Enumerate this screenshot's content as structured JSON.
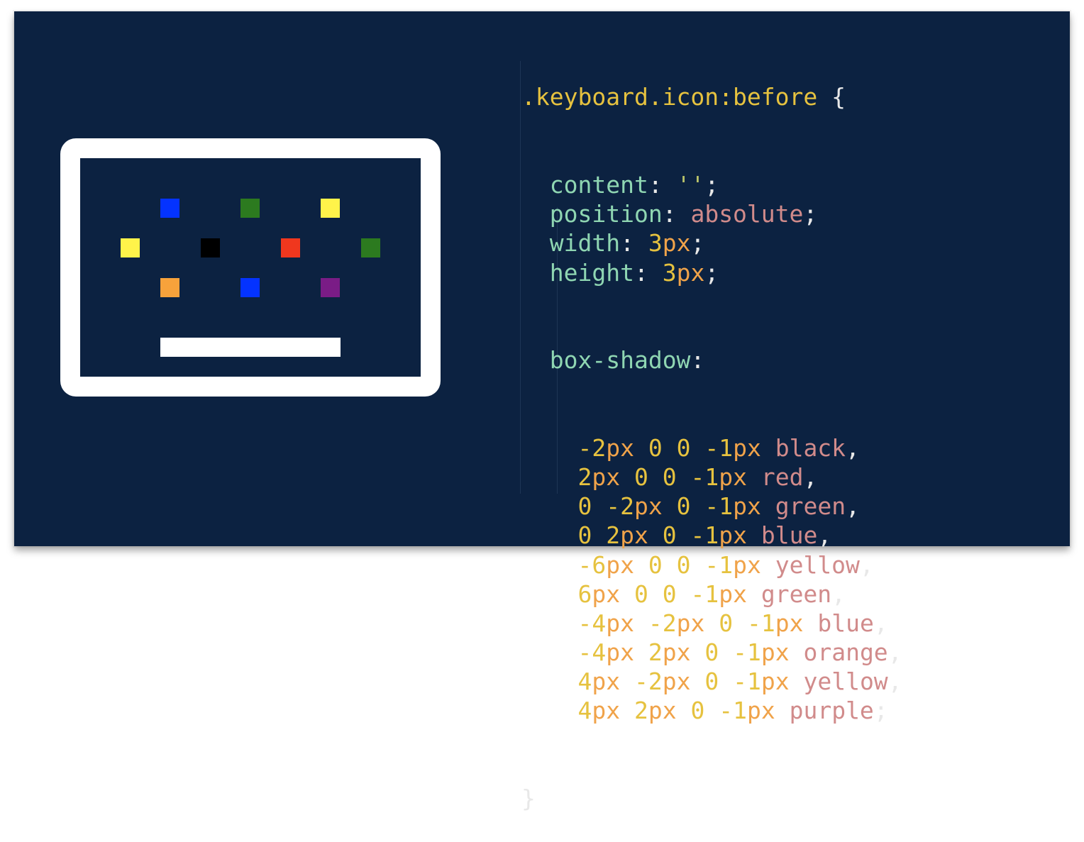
{
  "keyboard_icon": {
    "frame_color": "#ffffff",
    "background_color": "#0c2241",
    "key_colors": [
      "blue",
      "green",
      "yellow",
      "yellow",
      "black",
      "red",
      "green",
      "orange",
      "blue",
      "purple"
    ],
    "color_map": {
      "blue": "#0433ff",
      "green": "#2c7a1f",
      "yellow": "#fff34a",
      "black": "#000000",
      "red": "#f0371e",
      "orange": "#f7a23b",
      "purple": "#7a1c86"
    }
  },
  "code": {
    "selector": ".keyboard.icon:before",
    "open_brace": " {",
    "close_brace": "}",
    "declarations": [
      {
        "prop": "content",
        "value": "''",
        "type": "str"
      },
      {
        "prop": "position",
        "value": "absolute",
        "type": "kw"
      },
      {
        "prop": "width",
        "num": "3",
        "unit": "px"
      },
      {
        "prop": "height",
        "num": "3",
        "unit": "px"
      }
    ],
    "box_shadow_prop": "box-shadow",
    "shadows": [
      [
        "-2",
        "px",
        " 0 0 ",
        "-1",
        "px",
        " ",
        "black",
        ","
      ],
      [
        "2",
        "px",
        " 0 0 ",
        "-1",
        "px",
        " ",
        "red",
        ","
      ],
      [
        "0 ",
        "-2",
        "px",
        " 0 ",
        "-1",
        "px",
        " ",
        "green",
        ","
      ],
      [
        "0 ",
        "2",
        "px",
        " 0 ",
        "-1",
        "px",
        " ",
        "blue",
        ","
      ],
      [
        "-6",
        "px",
        " 0 0 ",
        "-1",
        "px",
        " ",
        "yellow",
        ","
      ],
      [
        "6",
        "px",
        " 0 0 ",
        "-1",
        "px",
        " ",
        "green",
        ","
      ],
      [
        "-4",
        "px",
        " ",
        "-2",
        "px",
        " 0 ",
        "-1",
        "px",
        " ",
        "blue",
        ","
      ],
      [
        "-4",
        "px",
        " ",
        "2",
        "px",
        " 0 ",
        "-1",
        "px",
        " ",
        "orange",
        ","
      ],
      [
        "4",
        "px",
        " ",
        "-2",
        "px",
        " 0 ",
        "-1",
        "px",
        " ",
        "yellow",
        ","
      ],
      [
        "4",
        "px",
        " ",
        "2",
        "px",
        " 0 ",
        "-1",
        "px",
        " ",
        "purple",
        ";"
      ]
    ]
  }
}
